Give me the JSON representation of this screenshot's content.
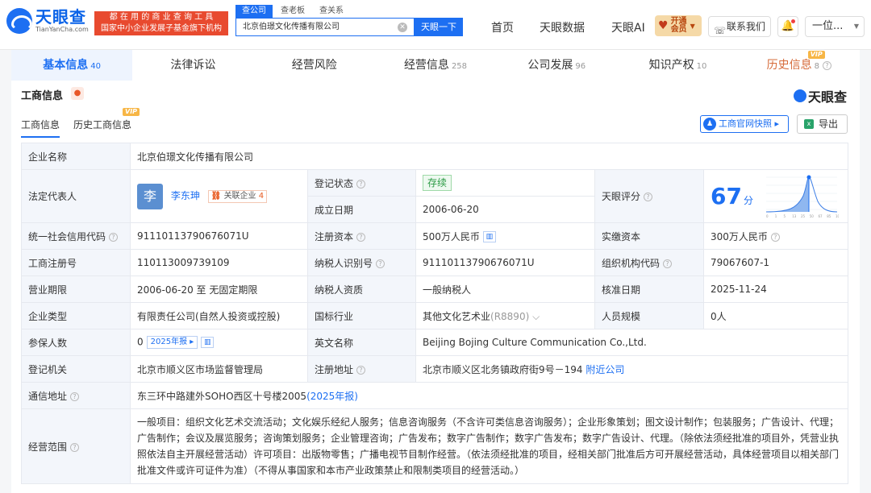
{
  "logo": {
    "cn": "天眼查",
    "en": "TianYanCha.com"
  },
  "slogan": {
    "line1": "都 在 用 的 商 业 查 询 工 具",
    "line2": "国家中小企业发展子基金旗下机构"
  },
  "search": {
    "tabs": [
      "查公司",
      "查老板",
      "查关系"
    ],
    "query": "北京伯璟文化传播有限公司",
    "button": "天眼一下"
  },
  "nav": {
    "home": "首页",
    "data": "天眼数据",
    "ai": "天眼AI",
    "vip_line1": "开通",
    "vip_line2": "会员",
    "contact": "联系我们",
    "user": "一位..."
  },
  "tabs": [
    {
      "label": "基本信息",
      "count": "40"
    },
    {
      "label": "法律诉讼",
      "count": ""
    },
    {
      "label": "经营风险",
      "count": ""
    },
    {
      "label": "经营信息",
      "count": "258"
    },
    {
      "label": "公司发展",
      "count": "96"
    },
    {
      "label": "知识产权",
      "count": "10"
    },
    {
      "label": "历史信息",
      "count": "8"
    }
  ],
  "vip_tag": "VIP",
  "panel": {
    "title": "工商信息",
    "brand": "天眼查",
    "subtab1": "工商信息",
    "subtab2": "历史工商信息",
    "official": "工商官网快照",
    "export": "导出"
  },
  "info": {
    "company_name_label": "企业名称",
    "company_name": "北京伯璟文化传播有限公司",
    "legal_rep_label": "法定代表人",
    "legal_rep_avatar": "李",
    "legal_rep": "李东珅",
    "related_label": "关联企业",
    "related_count": "4",
    "reg_status_label": "登记状态",
    "reg_status": "存续",
    "found_date_label": "成立日期",
    "found_date": "2006-06-20",
    "score_label": "天眼评分",
    "score": "67",
    "score_unit": "分",
    "credit_code_label": "统一社会信用代码",
    "credit_code": "91110113790676071U",
    "reg_capital_label": "注册资本",
    "reg_capital": "500万人民币",
    "paid_capital_label": "实缴资本",
    "paid_capital": "300万人民币",
    "reg_no_label": "工商注册号",
    "reg_no": "110113009739109",
    "taxpayer_id_label": "纳税人识别号",
    "taxpayer_id": "91110113790676071U",
    "org_code_label": "组织机构代码",
    "org_code": "79067607-1",
    "term_label": "营业期限",
    "term": "2006-06-20 至 无固定期限",
    "taxpayer_qual_label": "纳税人资质",
    "taxpayer_qual": "一般纳税人",
    "approve_date_label": "核准日期",
    "approve_date": "2025-11-24",
    "type_label": "企业类型",
    "type": "有限责任公司(自然人投资或控股)",
    "industry_label": "国标行业",
    "industry": "其他文化艺术业",
    "industry_code": "(R8890)",
    "staff_label": "人员规模",
    "staff": "0人",
    "insured_label": "参保人数",
    "insured": "0",
    "insured_report": "2025年报",
    "en_name_label": "英文名称",
    "en_name": "Beijing Bojing Culture Communication Co.,Ltd.",
    "authority_label": "登记机关",
    "authority": "北京市顺义区市场监督管理局",
    "reg_addr_label": "注册地址",
    "reg_addr": "北京市顺义区北务镇政府街9号－194",
    "nearby": "附近公司",
    "mail_addr_label": "通信地址",
    "mail_addr": "东三环中路建外SOHO西区十号楼2005",
    "mail_report": "(2025年报)",
    "scope_label": "经营范围",
    "scope": "一般项目：组织文化艺术交流活动；文化娱乐经纪人服务；信息咨询服务（不含许可类信息咨询服务）；企业形象策划；图文设计制作；包装服务；广告设计、代理；广告制作；会议及展览服务；咨询策划服务；企业管理咨询；广告发布；数字广告制作；数字广告发布；数字广告设计、代理。（除依法须经批准的项目外，凭营业执照依法自主开展经营活动）许可项目：出版物零售；广播电视节目制作经营。（依法须经批准的项目，经相关部门批准后方可开展经营活动，具体经营项目以相关部门批准文件或许可证件为准）（不得从事国家和本市产业政策禁止和限制类项目的经营活动。）"
  },
  "score_chart": {
    "xticks": [
      "0",
      "1",
      "5",
      "13",
      "25",
      "50",
      "67",
      "85",
      "100"
    ]
  }
}
